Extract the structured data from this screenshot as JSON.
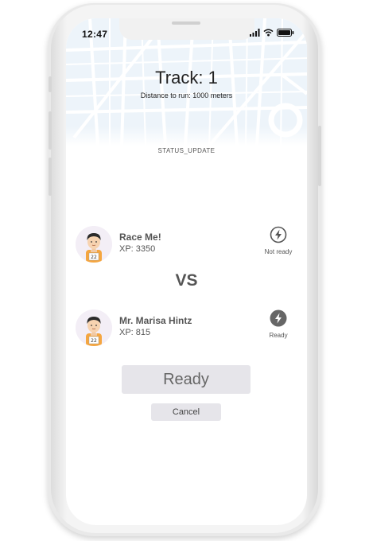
{
  "status_bar": {
    "time": "12:47"
  },
  "header": {
    "title": "Track: 1",
    "subtitle": "Distance to run: 1000 meters",
    "status_update": "STATUS_UPDATE"
  },
  "players": [
    {
      "name": "Race Me!",
      "xp": "XP: 3350",
      "status_label": "Not ready",
      "status_icon": "lightning-outline-icon",
      "bib": "22"
    },
    {
      "name": "Mr. Marisa Hintz",
      "xp": "XP: 815",
      "status_label": "Ready",
      "status_icon": "lightning-filled-icon",
      "bib": "22"
    }
  ],
  "versus": "VS",
  "actions": {
    "ready_label": "Ready",
    "cancel_label": "Cancel"
  },
  "colors": {
    "map_bg": "#edf4fa",
    "map_road": "#ffffff",
    "button_bg": "#e6e5ea",
    "text_gray": "#555555"
  }
}
